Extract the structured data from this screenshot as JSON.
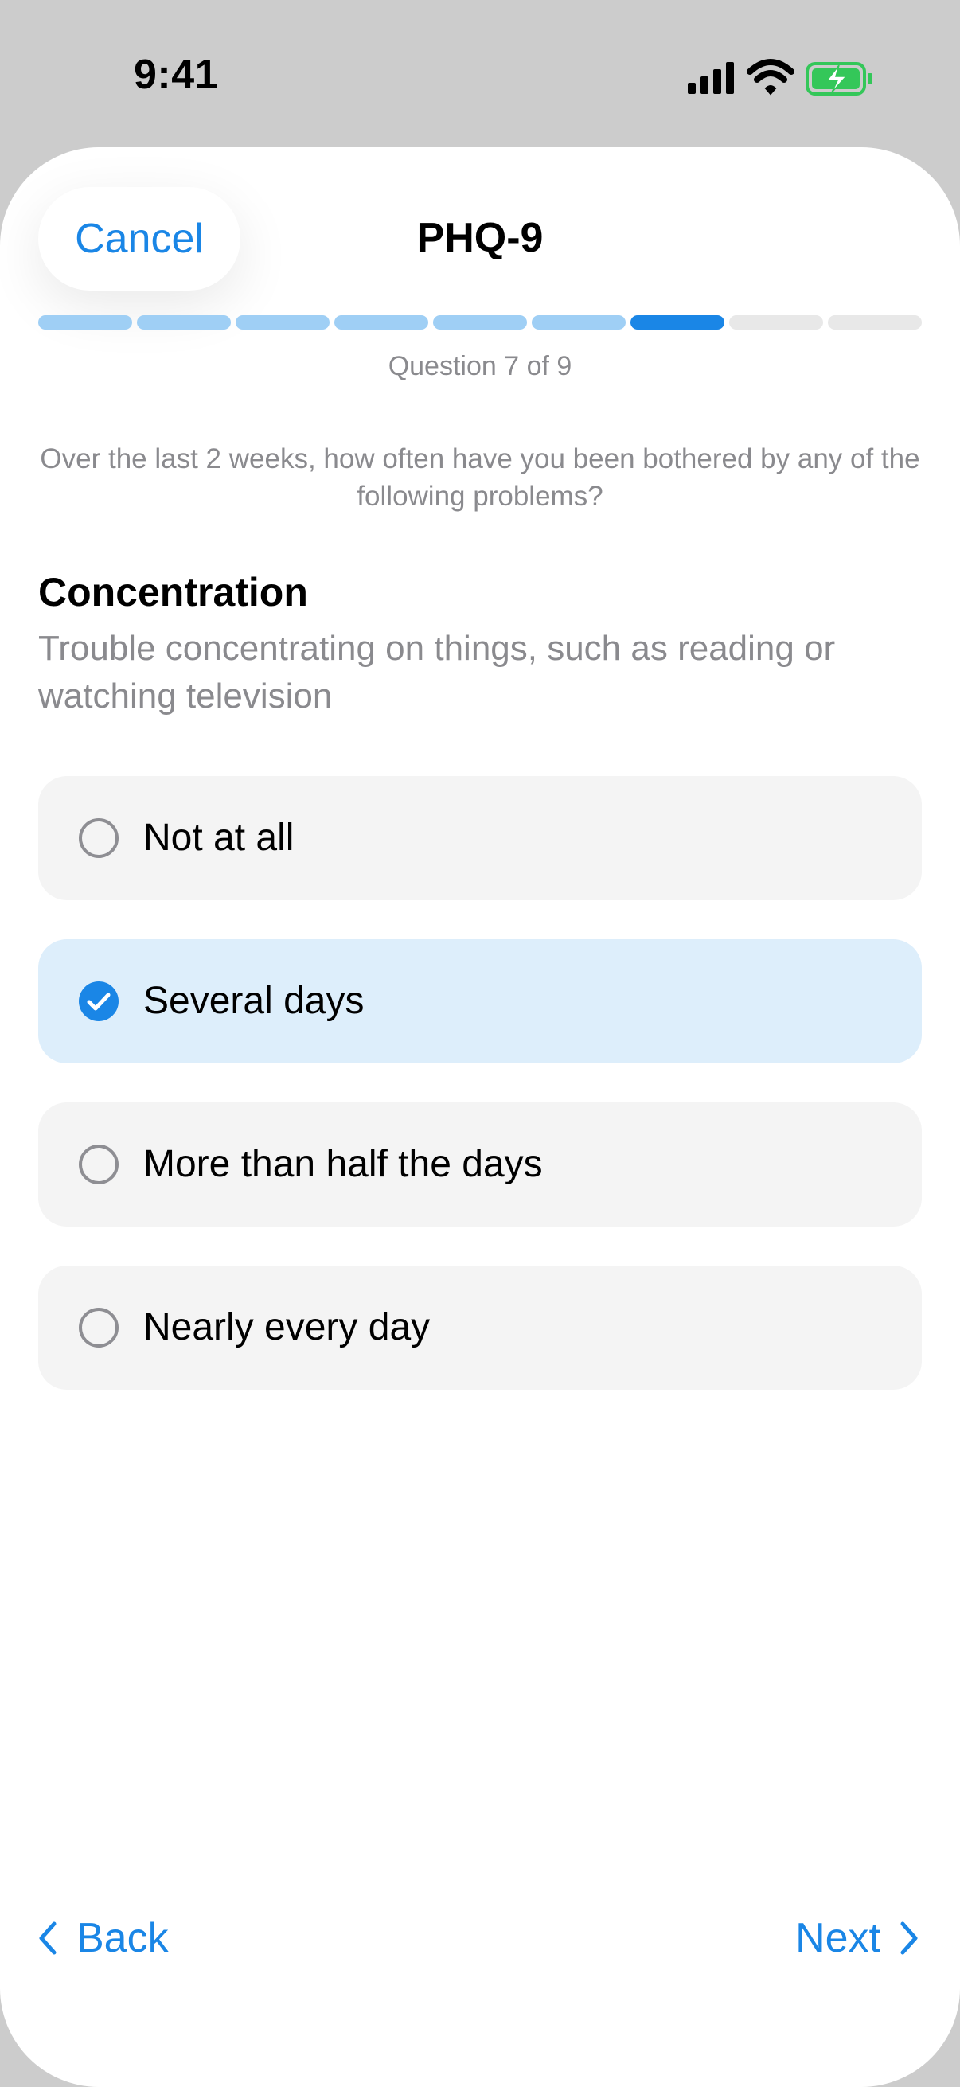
{
  "status_bar": {
    "time": "9:41",
    "icons": [
      "cellular-signal-icon",
      "wifi-icon",
      "battery-charging-icon"
    ],
    "battery_color": "#34c759"
  },
  "header": {
    "cancel_label": "Cancel",
    "title": "PHQ-9"
  },
  "progress": {
    "current": 7,
    "total": 9,
    "counter_text": "Question 7 of 9",
    "completed_color": "#9fcff5",
    "current_color": "#1a86e6",
    "remaining_color": "#e8e8e8"
  },
  "instructions": "Over the last 2 weeks, how often have you been bothered by any of the following problems?",
  "question": {
    "title": "Concentration",
    "description": "Trouble concentrating on things, such as reading or watching television"
  },
  "options": [
    {
      "label": "Not at all",
      "selected": false
    },
    {
      "label": "Several days",
      "selected": true
    },
    {
      "label": "More than half the days",
      "selected": false
    },
    {
      "label": "Nearly every day",
      "selected": false
    }
  ],
  "footer": {
    "back_label": "Back",
    "next_label": "Next"
  },
  "colors": {
    "accent": "#1a86e6",
    "selected_background": "#ddeefb",
    "option_background": "#f4f4f4"
  }
}
